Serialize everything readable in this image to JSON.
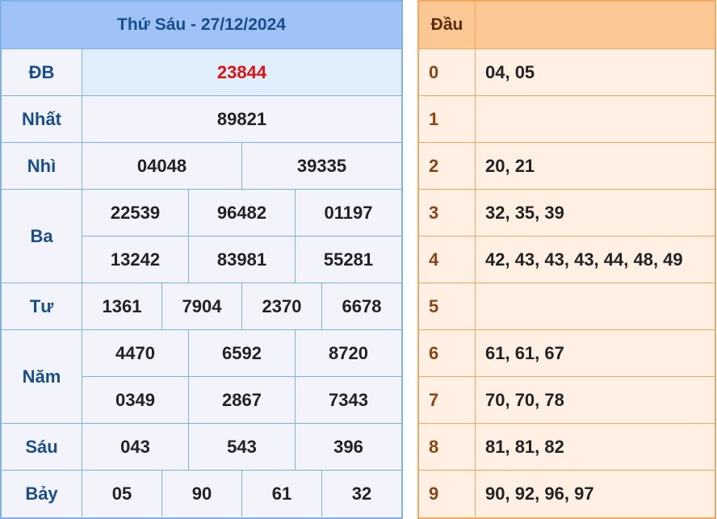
{
  "results": {
    "title": "Thứ Sáu - 27/12/2024",
    "prizes": [
      {
        "label": "ĐB",
        "rows": [
          [
            "23844"
          ]
        ]
      },
      {
        "label": "Nhất",
        "rows": [
          [
            "89821"
          ]
        ]
      },
      {
        "label": "Nhì",
        "rows": [
          [
            "04048",
            "39335"
          ]
        ]
      },
      {
        "label": "Ba",
        "rows": [
          [
            "22539",
            "96482",
            "01197"
          ],
          [
            "13242",
            "83981",
            "55281"
          ]
        ]
      },
      {
        "label": "Tư",
        "rows": [
          [
            "1361",
            "7904",
            "2370",
            "6678"
          ]
        ]
      },
      {
        "label": "Năm",
        "rows": [
          [
            "4470",
            "6592",
            "8720"
          ],
          [
            "0349",
            "2867",
            "7343"
          ]
        ]
      },
      {
        "label": "Sáu",
        "rows": [
          [
            "043",
            "543",
            "396"
          ]
        ]
      },
      {
        "label": "Bảy",
        "rows": [
          [
            "05",
            "90",
            "61",
            "32"
          ]
        ]
      }
    ]
  },
  "dau": {
    "header": "Đầu",
    "rows": [
      {
        "head": "0",
        "values": "04, 05"
      },
      {
        "head": "1",
        "values": ""
      },
      {
        "head": "2",
        "values": "20, 21"
      },
      {
        "head": "3",
        "values": "32, 35, 39"
      },
      {
        "head": "4",
        "values": "42, 43, 43, 43, 44, 48, 49"
      },
      {
        "head": "5",
        "values": ""
      },
      {
        "head": "6",
        "values": "61, 61, 67"
      },
      {
        "head": "7",
        "values": "70, 70, 78"
      },
      {
        "head": "8",
        "values": "81, 81, 82"
      },
      {
        "head": "9",
        "values": "90, 92, 96, 97"
      }
    ]
  }
}
